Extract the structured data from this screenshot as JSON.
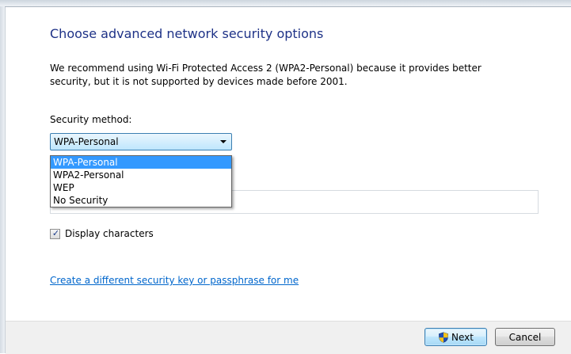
{
  "dialog": {
    "title": "Choose advanced network security options",
    "description": "We recommend using Wi-Fi Protected Access 2 (WPA2-Personal) because it provides better security,  but it is not supported by devices made before 2001."
  },
  "security": {
    "label": "Security method:",
    "selected_value": "WPA-Personal",
    "options": [
      "WPA-Personal",
      "WPA2-Personal",
      "WEP",
      "No Security"
    ],
    "highlighted_index": 0
  },
  "passphrase": {
    "value": ""
  },
  "display_characters": {
    "label": "Display characters",
    "checked": true
  },
  "link": {
    "label": "Create a different security key or passphrase for me"
  },
  "footer": {
    "next_label": "Next",
    "cancel_label": "Cancel"
  },
  "icons": {
    "next_button_icon": "uac-shield-icon",
    "select_arrow": "chevron-down-icon",
    "checkbox_mark": "checkmark-icon"
  },
  "colors": {
    "title": "#1e3287",
    "link": "#0066cc",
    "dropdown_highlight": "#3399ff",
    "footer_background": "#f0f0f0"
  }
}
